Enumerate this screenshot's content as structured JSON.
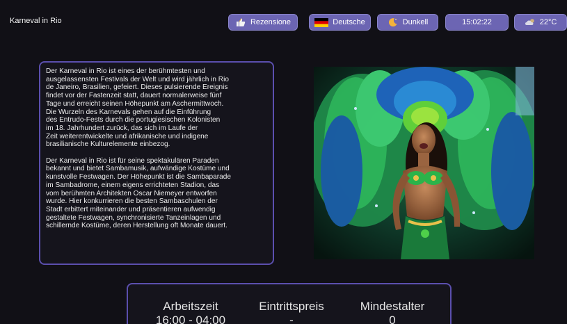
{
  "header": {
    "title": "Karneval in Rio",
    "review_label": "Rezensione",
    "language_label": "Deutsche",
    "theme_label": "Dunkell",
    "time": "15:02:22",
    "temperature": "22°C"
  },
  "article": {
    "paragraph_1": "Der Karneval in Rio ist eines der berühmtesten und\nausgelassensten Festivals der Welt und wird jährlich in Rio\nde Janeiro, Brasilien, gefeiert. Dieses pulsierende Ereignis\nfindet vor der Fastenzeit statt, dauert normalerweise fünf\nTage und erreicht seinen Höhepunkt am Aschermittwoch.\nDie Wurzeln des Karnevals gehen auf die Einführung\ndes Entrudo-Fests durch die portugiesischen Kolonisten\nim 18. Jahrhundert zurück, das sich im Laufe der\nZeit weiterentwickelte und afrikanische und indigene\nbrasilianische Kulturelemente einbezog.",
    "paragraph_2": "Der Karneval in Rio ist für seine spektakulären Paraden\nbekannt und bietet Sambamusik, aufwändige Kostüme und\nkunstvolle Festwagen. Der Höhepunkt ist die Sambaparade\nim Sambadrome, einem eigens errichteten Stadion, das\nvom berühmten Architekten Oscar Niemeyer entworfen\nwurde. Hier konkurrieren die besten Sambaschulen der\nStadt erbittert miteinander und präsentieren aufwendig\ngestaltete Festwagen, synchronisierte Tanzeinlagen und\nschillernde Kostüme, deren Herstellung oft Monate dauert."
  },
  "info": {
    "hours_label": "Arbeitszeit",
    "hours_value": "16:00 - 04:00",
    "price_label": "Eintrittspreis",
    "price_value": "-",
    "age_label": "Mindestalter",
    "age_value": "0"
  },
  "icons": {
    "review": "thumbs-up-icon",
    "language": "german-flag-icon",
    "theme": "moon-icon",
    "weather": "cloud-icon"
  },
  "colors": {
    "background": "#111016",
    "accent": "#6c65b3",
    "panel_border": "#5b4fae"
  }
}
